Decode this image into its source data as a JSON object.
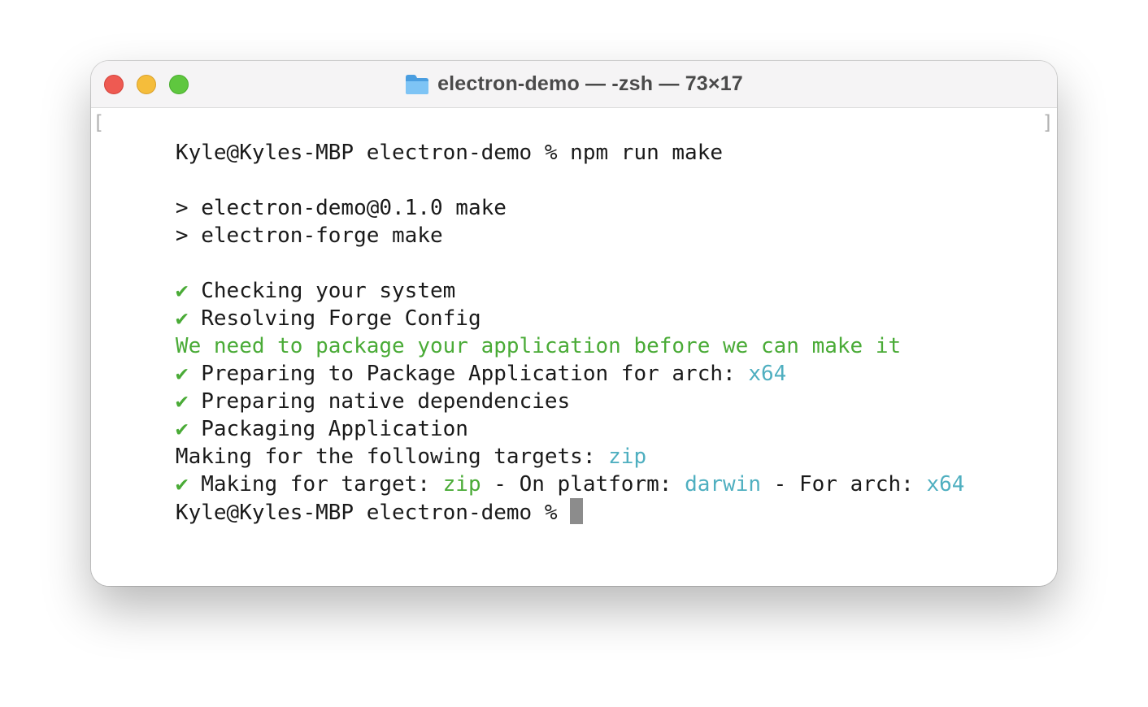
{
  "window": {
    "title": "electron-demo — -zsh — 73×17"
  },
  "colors": {
    "success": "#4aab37",
    "highlight": "#4fafc0",
    "text": "#1a1a1a",
    "close": "#ee5a52",
    "minimize": "#f5bd3b",
    "maximize": "#5fc73f"
  },
  "icons": {
    "check": "✔",
    "folder": "folder-icon"
  },
  "terminal": {
    "lines": [
      {
        "text": "Kyle@Kyles-MBP electron-demo % npm run make"
      },
      {
        "text": ""
      },
      {
        "text": "> electron-demo@0.1.0 make"
      },
      {
        "text": "> electron-forge make"
      },
      {
        "text": ""
      },
      {
        "text": " Checking your system"
      },
      {
        "text": " Resolving Forge Config"
      },
      {
        "text": "We need to package your application before we can make it"
      },
      {
        "prefix": " Preparing to Package Application for arch: ",
        "value": "x64"
      },
      {
        "text": " Preparing native dependencies"
      },
      {
        "text": " Packaging Application"
      },
      {
        "prefix": "Making for the following targets: ",
        "value": "zip"
      },
      {
        "p1": " Making for target: ",
        "v1": "zip",
        "p2": " - On platform: ",
        "v2": "darwin",
        "p3": " - For arch: ",
        "v3": "x64"
      },
      {
        "text": "Kyle@Kyles-MBP electron-demo % "
      }
    ]
  }
}
